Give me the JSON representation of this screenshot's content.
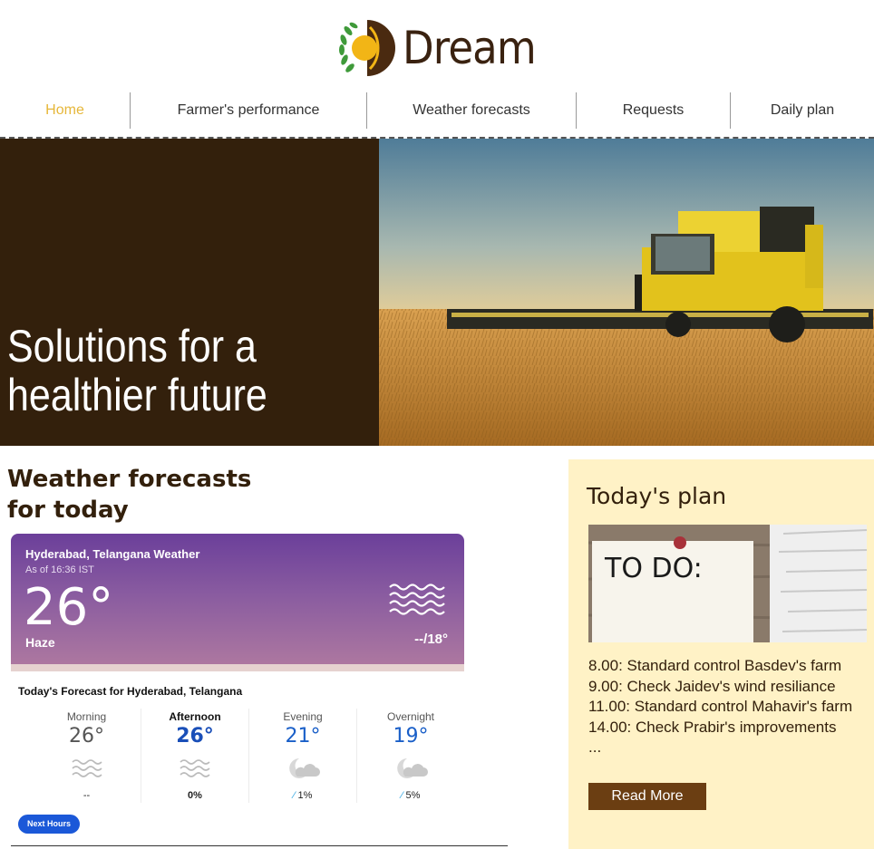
{
  "brand": {
    "name": "Dream"
  },
  "nav": {
    "items": [
      {
        "label": "Home",
        "active": true
      },
      {
        "label": "Farmer's performance",
        "active": false
      },
      {
        "label": "Weather forecasts",
        "active": false
      },
      {
        "label": "Requests",
        "active": false
      },
      {
        "label": "Daily plan",
        "active": false
      }
    ]
  },
  "hero": {
    "line1": "Solutions for a",
    "line2": "healthier future"
  },
  "weather": {
    "heading_line1": "Weather forecasts",
    "heading_line2": "for today",
    "current": {
      "location": "Hyderabad, Telangana Weather",
      "as_of": "As of 16:36 IST",
      "temperature": "26°",
      "condition": "Haze",
      "range": "--/18°"
    },
    "forecast_title": "Today's Forecast for Hyderabad, Telangana",
    "periods": [
      {
        "name": "Morning",
        "temp": "26°",
        "precip": "--",
        "icon": "haze-icon"
      },
      {
        "name": "Afternoon",
        "temp": "26°",
        "precip": "0%",
        "icon": "haze-icon"
      },
      {
        "name": "Evening",
        "temp": "21°",
        "precip": "1%",
        "icon": "partly-cloudy-night-icon"
      },
      {
        "name": "Overnight",
        "temp": "19°",
        "precip": "5%",
        "icon": "partly-cloudy-night-icon"
      }
    ],
    "next_hours_label": "Next Hours"
  },
  "plan": {
    "title": "Today's plan",
    "image_text": "TO DO:",
    "items": [
      "8.00:  Standard control Basdev's farm",
      "9.00:  Check Jaidev's wind resiliance",
      "11.00: Standard control Mahavir's farm",
      "14.00: Check Prabir's improvements",
      "..."
    ],
    "button_label": "Read More"
  },
  "colors": {
    "brand_brown": "#33200c",
    "nav_active": "#e6b73a",
    "plan_bg": "#fff2c6",
    "button_brown": "#6b3e12",
    "weather_purple": "#6b3f9a",
    "next_hours_blue": "#1b58d8"
  }
}
